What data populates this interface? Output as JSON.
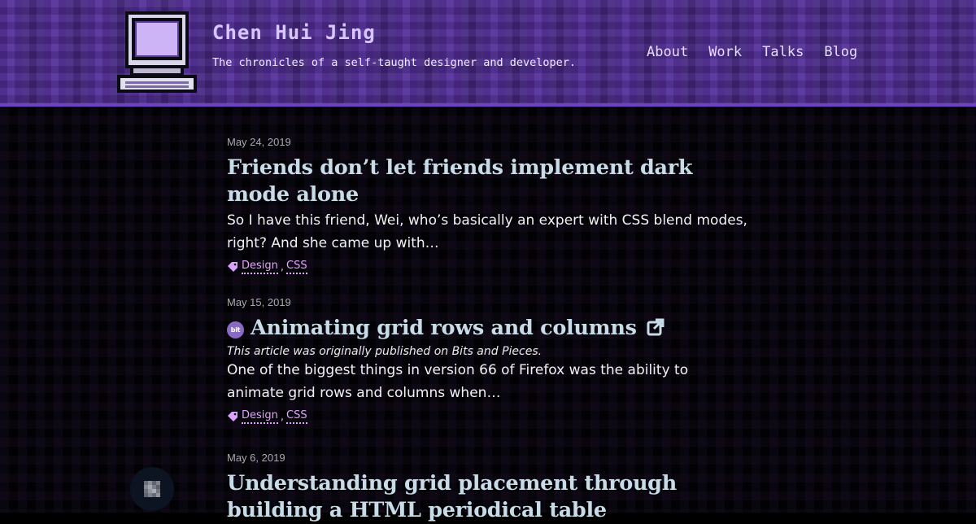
{
  "site": {
    "title": "Chen Hui Jing",
    "tagline": "The chronicles of a self-taught designer and developer."
  },
  "nav": {
    "items": [
      {
        "label": "About"
      },
      {
        "label": "Work"
      },
      {
        "label": "Talks"
      },
      {
        "label": "Blog"
      }
    ]
  },
  "posts": [
    {
      "date": "May 24, 2019",
      "title": "Friends don’t let friends implement dark mode alone",
      "excerpt": "So I have this friend, Wei, who’s basically an expert with CSS blend modes, right? And she came up with…",
      "tags": [
        "Design",
        "CSS"
      ]
    },
    {
      "date": "May 15, 2019",
      "badge": "bit",
      "title": "Animating grid rows and columns",
      "note": "This article was originally published on Bits and Pieces.",
      "excerpt": "One of the biggest things in version 66 of Firefox was the ability to animate grid rows and columns when…",
      "tags": [
        "Design",
        "CSS"
      ]
    },
    {
      "date": "May 6, 2019",
      "title": "Understanding grid placement through building a HTML periodical table"
    }
  ],
  "tag_separator": ",",
  "icons": {
    "logo": "retro-computer-icon",
    "tag": "tag-icon",
    "external_link": "external-link-icon",
    "floating": "pixel-avatar-icon"
  },
  "colors": {
    "header_bg": "#4f2d8f",
    "title_text": "#c8dce8",
    "tag_link": "#e4a3ff"
  }
}
